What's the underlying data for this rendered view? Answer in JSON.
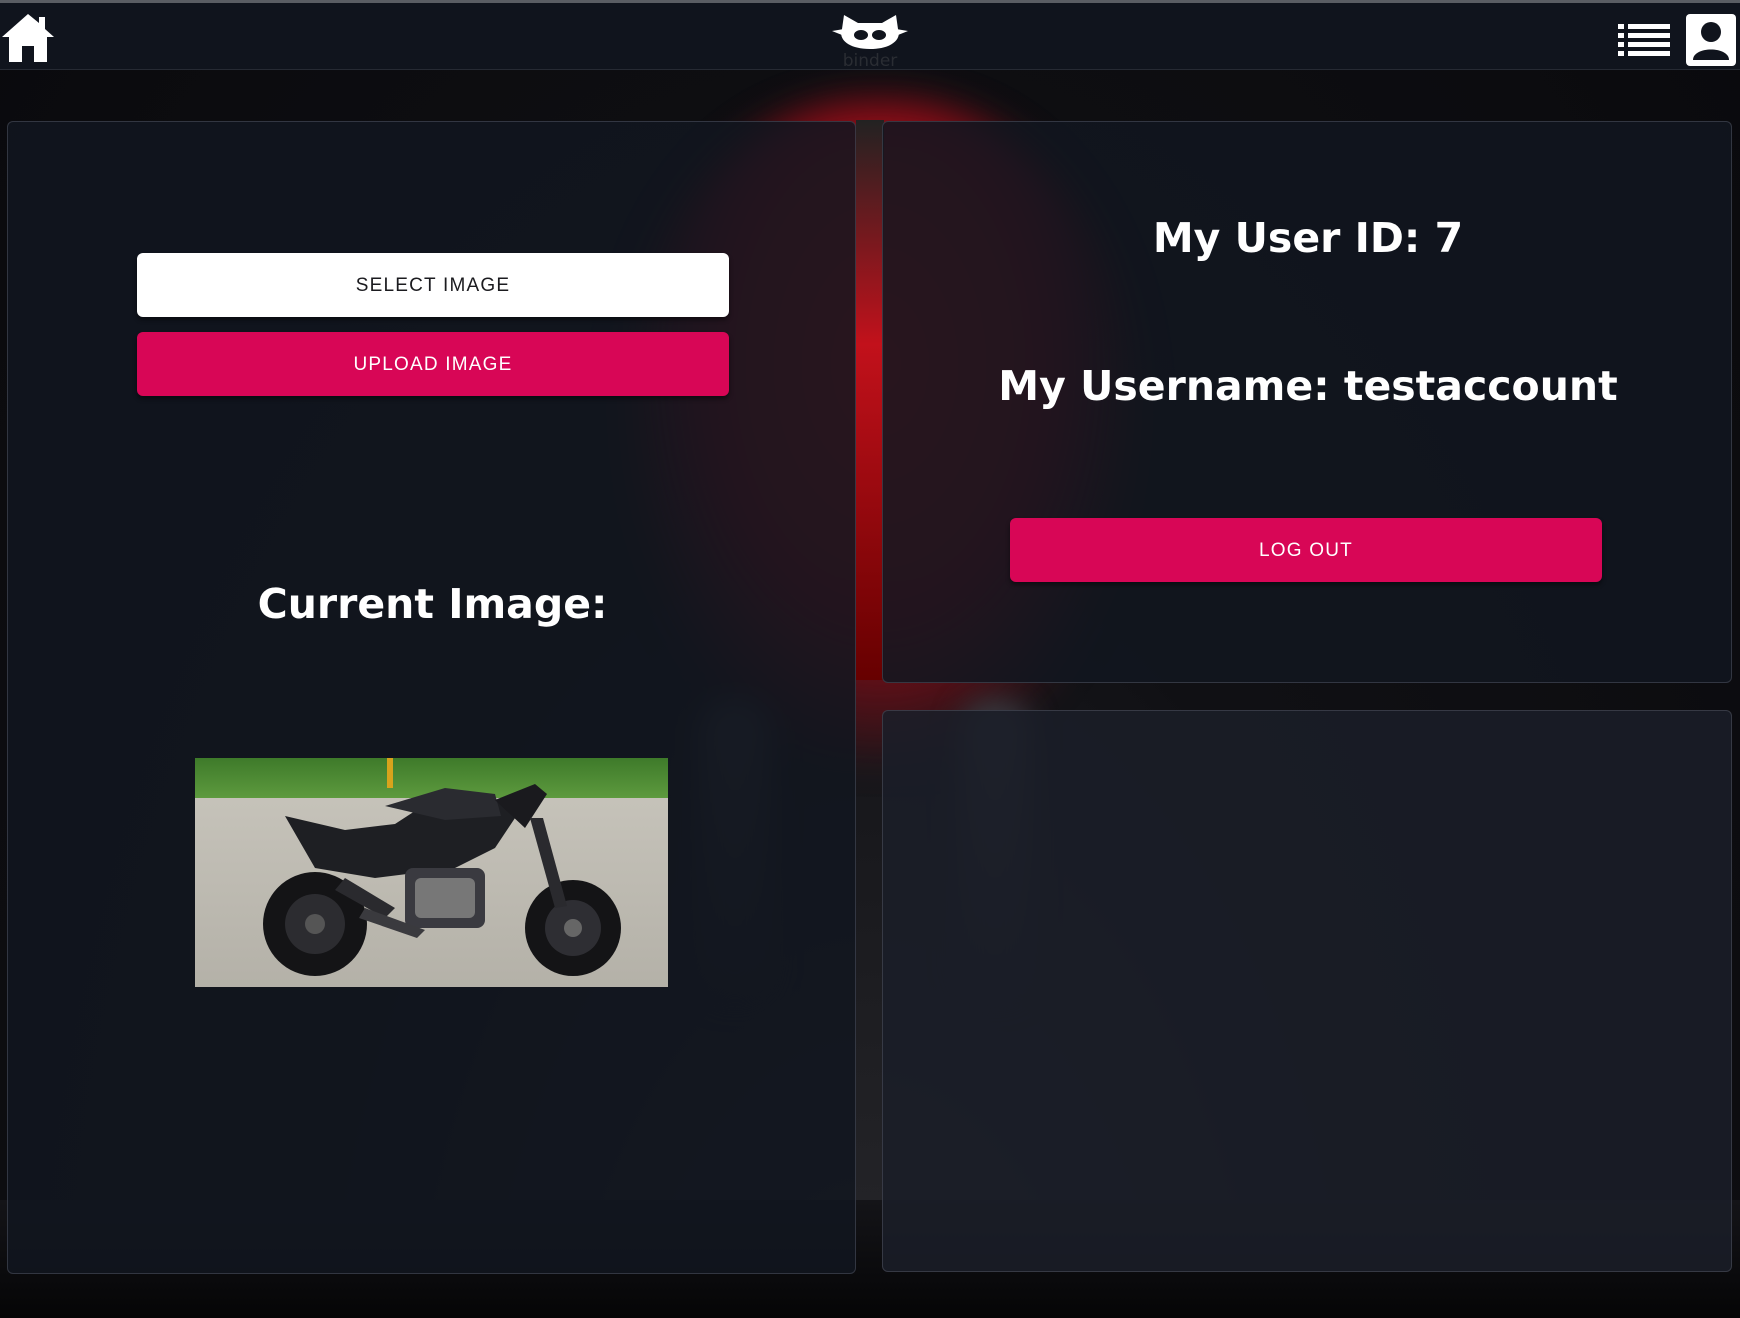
{
  "header": {
    "logo_text": "binder",
    "icons": {
      "home": "home-icon",
      "list": "list-icon",
      "account": "account-icon"
    }
  },
  "upload_panel": {
    "select_label": "SELECT IMAGE",
    "upload_label": "UPLOAD IMAGE",
    "current_label": "Current Image:",
    "image_description": "black-motorcycle-photo"
  },
  "user_panel": {
    "user_id_text": "My User ID: 7",
    "username_text": "My Username: testaccount",
    "logout_label": "LOG OUT"
  },
  "colors": {
    "accent": "#d80656",
    "panel_bg": "#121620",
    "nav_bg": "#10141d"
  }
}
